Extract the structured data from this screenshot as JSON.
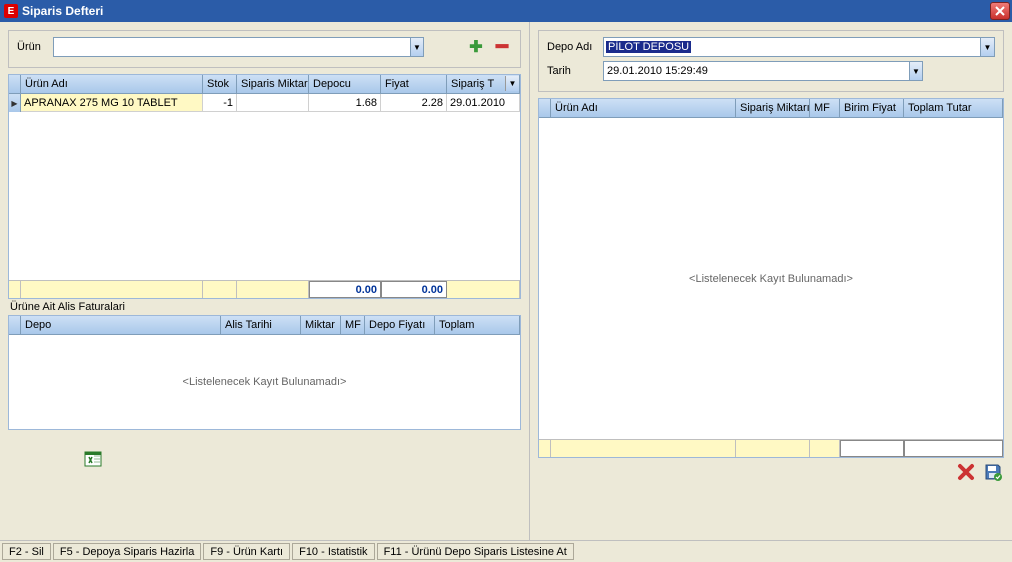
{
  "title": "Siparis Defteri",
  "left": {
    "urun_label": "Ürün",
    "urun_value": "",
    "table1": {
      "headers": [
        "Ürün Adı",
        "Stok",
        "Siparis Miktarı",
        "Depocu",
        "Fiyat",
        "Sipariş T"
      ],
      "rows": [
        {
          "urun": "APRANAX 275 MG 10 TABLET",
          "stok": "-1",
          "miktar": "",
          "depocu": "1.68",
          "fiyat": "2.28",
          "tarih": "29.01.2010"
        }
      ],
      "footer": {
        "col3": "0.00",
        "col4": "0.00"
      }
    },
    "sub_label": "Ürüne Ait Alis Faturalari",
    "table2": {
      "headers": [
        "Depo",
        "Alis Tarihi",
        "Miktar",
        "MF",
        "Depo Fiyatı",
        "Toplam"
      ],
      "empty": "<Listelenecek Kayıt Bulunamadı>"
    }
  },
  "right": {
    "depo_label": "Depo Adı",
    "depo_value": "PİLOT DEPOSU",
    "tarih_label": "Tarih",
    "tarih_value": "29.01.2010 15:29:49",
    "table": {
      "headers": [
        "Ürün Adı",
        "Sipariş Miktarı",
        "MF",
        "Birim Fiyat",
        "Toplam Tutar"
      ],
      "empty": "<Listelenecek Kayıt Bulunamadı>"
    }
  },
  "status": {
    "f2": "F2 - Sil",
    "f5": "F5 - Depoya Siparis Hazirla",
    "f9": "F9 - Ürün Kartı",
    "f10": "F10 - Istatistik",
    "f11": "F11 - Ürünü Depo Siparis Listesine At"
  }
}
